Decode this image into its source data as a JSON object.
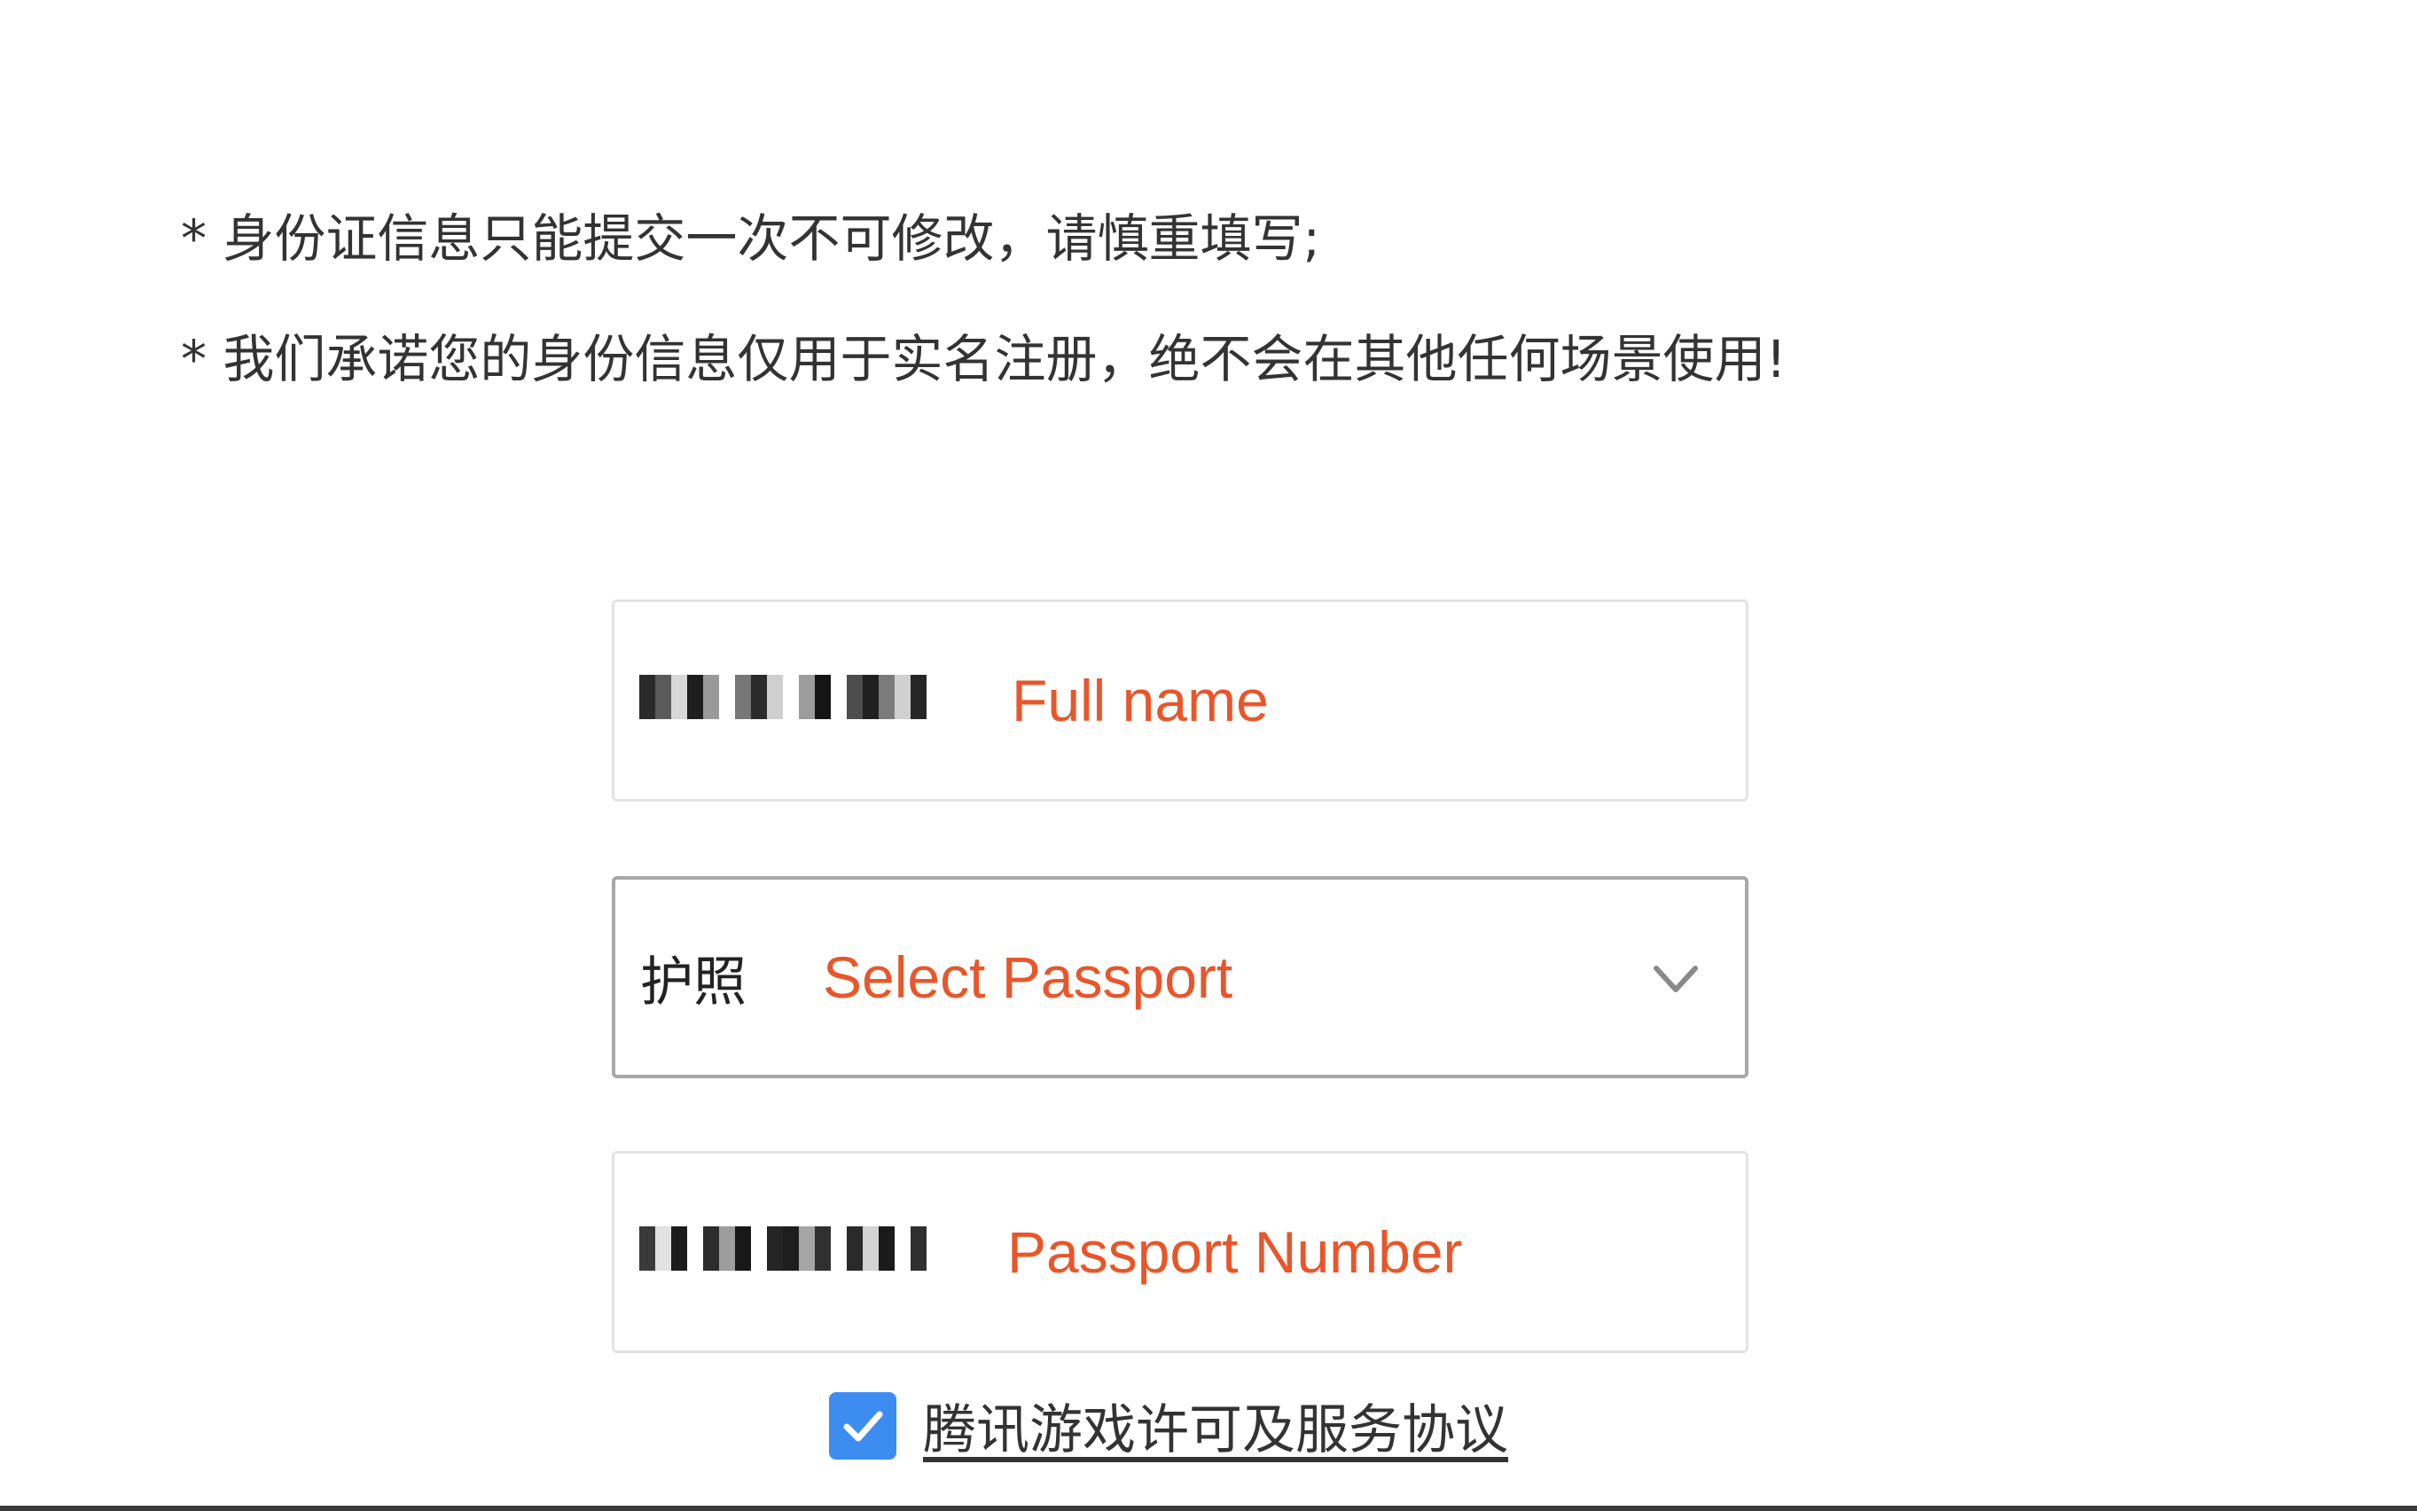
{
  "notices": {
    "line1": "* 身份证信息只能提交一次不可修改，请慎重填写;",
    "line2": "* 我们承诺您的身份信息仅用于实名注册，绝不会在其他任何场景使用!"
  },
  "form": {
    "full_name": {
      "hint": "Full name"
    },
    "id_type": {
      "value": "护照",
      "hint": "Select Passport"
    },
    "id_number": {
      "hint": "Passport Number"
    }
  },
  "agreement": {
    "checked": true,
    "label": "腾讯游戏许可及服务协议"
  },
  "colors": {
    "hint": "#e8562a",
    "checkbox": "#3d8cf0",
    "border": "#e3e3e3",
    "active_border": "#a8a8a8"
  },
  "icons": {
    "dropdown": "chevron-down-icon",
    "checkbox": "checkmark-icon"
  }
}
